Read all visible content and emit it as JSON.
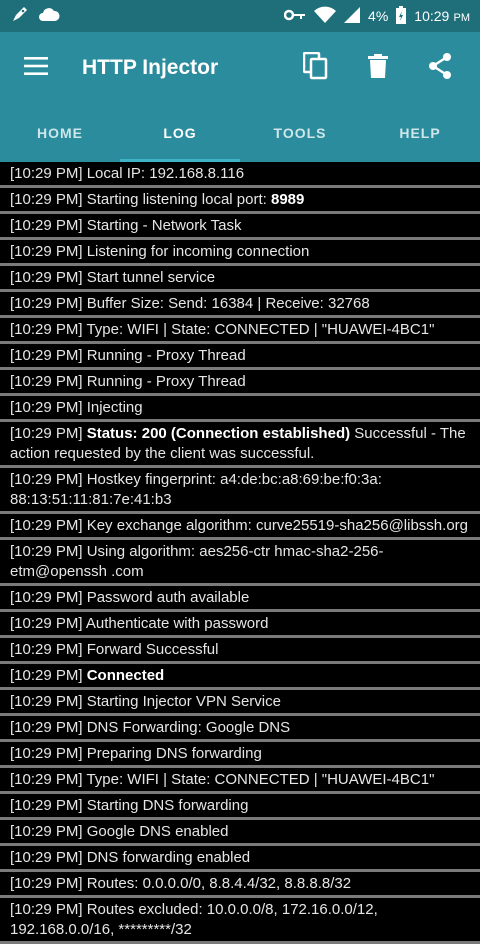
{
  "status_bar": {
    "battery": "4%",
    "time": "10:29",
    "ampm": "PM"
  },
  "toolbar": {
    "title": "HTTP Injector"
  },
  "tabs": [
    {
      "label": "HOME"
    },
    {
      "label": "LOG"
    },
    {
      "label": "TOOLS"
    },
    {
      "label": "HELP"
    }
  ],
  "log": [
    {
      "ts": "[10:29 PM]",
      "pre": " Local IP: 192.168.8.116",
      "bold": "",
      "post": ""
    },
    {
      "ts": "[10:29 PM]",
      "pre": " Starting listening local port: ",
      "bold": "8989",
      "post": ""
    },
    {
      "ts": "[10:29 PM]",
      "pre": " Starting - Network Task",
      "bold": "",
      "post": ""
    },
    {
      "ts": "[10:29 PM]",
      "pre": " Listening for incoming connection",
      "bold": "",
      "post": ""
    },
    {
      "ts": "[10:29 PM]",
      "pre": " Start tunnel service",
      "bold": "",
      "post": ""
    },
    {
      "ts": "[10:29 PM]",
      "pre": " Buffer Size: Send: 16384 | Receive: 32768",
      "bold": "",
      "post": ""
    },
    {
      "ts": "[10:29 PM]",
      "pre": " Type: WIFI | State: CONNECTED | \"HUAWEI-4BC1\"",
      "bold": "",
      "post": ""
    },
    {
      "ts": "[10:29 PM]",
      "pre": " Running - Proxy Thread",
      "bold": "",
      "post": ""
    },
    {
      "ts": "[10:29 PM]",
      "pre": " Running - Proxy Thread",
      "bold": "",
      "post": ""
    },
    {
      "ts": "[10:29 PM]",
      "pre": " Injecting",
      "bold": "",
      "post": ""
    },
    {
      "ts": "[10:29 PM]",
      "pre": " ",
      "bold": "Status: 200 (Connection established)",
      "post": " Successful - The action requested by the client was successful."
    },
    {
      "ts": "[10:29 PM]",
      "pre": " Hostkey fingerprint: a4:de:bc:a8:69:be:f0:3a: 88:13:51:11:81:7e:41:b3",
      "bold": "",
      "post": ""
    },
    {
      "ts": "[10:29 PM]",
      "pre": " Key exchange algorithm: curve25519-sha256@libssh.org",
      "bold": "",
      "post": ""
    },
    {
      "ts": "[10:29 PM]",
      "pre": " Using algorithm: aes256-ctr hmac-sha2-256-etm@openssh .com",
      "bold": "",
      "post": ""
    },
    {
      "ts": "[10:29 PM]",
      "pre": " Password auth available",
      "bold": "",
      "post": ""
    },
    {
      "ts": "[10:29 PM]",
      "pre": " Authenticate with password",
      "bold": "",
      "post": ""
    },
    {
      "ts": "[10:29 PM]",
      "pre": " Forward Successful",
      "bold": "",
      "post": ""
    },
    {
      "ts": "[10:29 PM]",
      "pre": " ",
      "bold": "Connected",
      "post": ""
    },
    {
      "ts": "[10:29 PM]",
      "pre": " Starting Injector VPN Service",
      "bold": "",
      "post": ""
    },
    {
      "ts": "[10:29 PM]",
      "pre": " DNS Forwarding: Google DNS",
      "bold": "",
      "post": ""
    },
    {
      "ts": "[10:29 PM]",
      "pre": " Preparing DNS forwarding",
      "bold": "",
      "post": ""
    },
    {
      "ts": "[10:29 PM]",
      "pre": " Type: WIFI | State: CONNECTED | \"HUAWEI-4BC1\"",
      "bold": "",
      "post": ""
    },
    {
      "ts": "[10:29 PM]",
      "pre": " Starting DNS forwarding",
      "bold": "",
      "post": ""
    },
    {
      "ts": "[10:29 PM]",
      "pre": " Google DNS enabled",
      "bold": "",
      "post": ""
    },
    {
      "ts": "[10:29 PM]",
      "pre": " DNS forwarding enabled",
      "bold": "",
      "post": ""
    },
    {
      "ts": "[10:29 PM]",
      "pre": " Routes: 0.0.0.0/0, 8.8.4.4/32, 8.8.8.8/32",
      "bold": "",
      "post": ""
    },
    {
      "ts": "[10:29 PM]",
      "pre": " Routes excluded: 10.0.0.0/8, 172.16.0.0/12, 192.168.0.0/16, *********/32",
      "bold": "",
      "post": ""
    }
  ]
}
